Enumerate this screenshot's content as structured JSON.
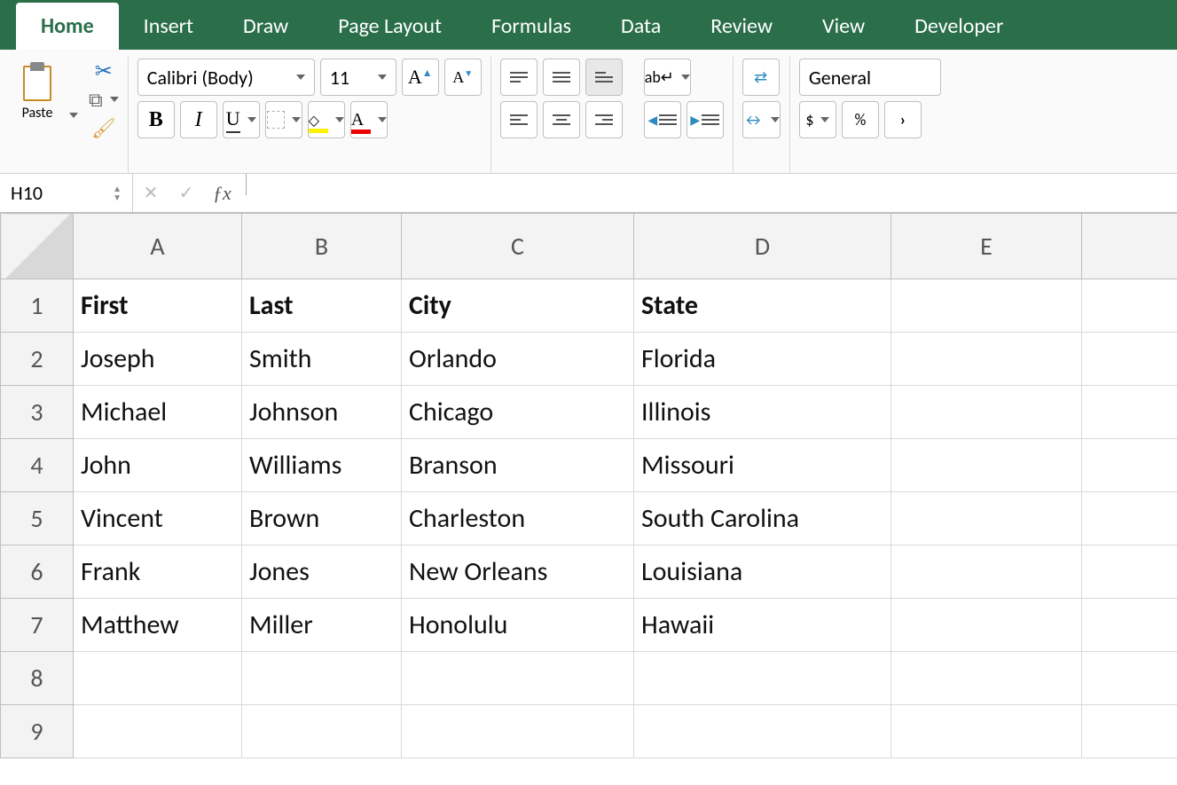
{
  "tabs": {
    "home": "Home",
    "insert": "Insert",
    "draw": "Draw",
    "page_layout": "Page Layout",
    "formulas": "Formulas",
    "data": "Data",
    "review": "Review",
    "view": "View",
    "developer": "Developer",
    "active": "home"
  },
  "ribbon": {
    "paste_label": "Paste",
    "font_name": "Calibri (Body)",
    "font_size": "11",
    "bold": "B",
    "italic": "I",
    "underline": "U",
    "font_color_letter": "A",
    "increase_font": "A",
    "decrease_font": "A",
    "number_format": "General",
    "currency": "$",
    "percent": "%"
  },
  "formula_bar": {
    "name_box": "H10",
    "formula": ""
  },
  "grid": {
    "columns": [
      "A",
      "B",
      "C",
      "D",
      "E",
      ""
    ],
    "rows_shown": 9,
    "headers": {
      "A": "First",
      "B": "Last",
      "C": "City",
      "D": "State"
    },
    "data": [
      {
        "A": "Joseph",
        "B": "Smith",
        "C": "Orlando",
        "D": "Florida"
      },
      {
        "A": "Michael",
        "B": "Johnson",
        "C": "Chicago",
        "D": "Illinois"
      },
      {
        "A": "John",
        "B": "Williams",
        "C": "Branson",
        "D": "Missouri"
      },
      {
        "A": "Vincent",
        "B": "Brown",
        "C": "Charleston",
        "D": "South Carolina"
      },
      {
        "A": "Frank",
        "B": "Jones",
        "C": "New Orleans",
        "D": "Louisiana"
      },
      {
        "A": "Matthew",
        "B": "Miller",
        "C": "Honolulu",
        "D": "Hawaii"
      }
    ]
  }
}
